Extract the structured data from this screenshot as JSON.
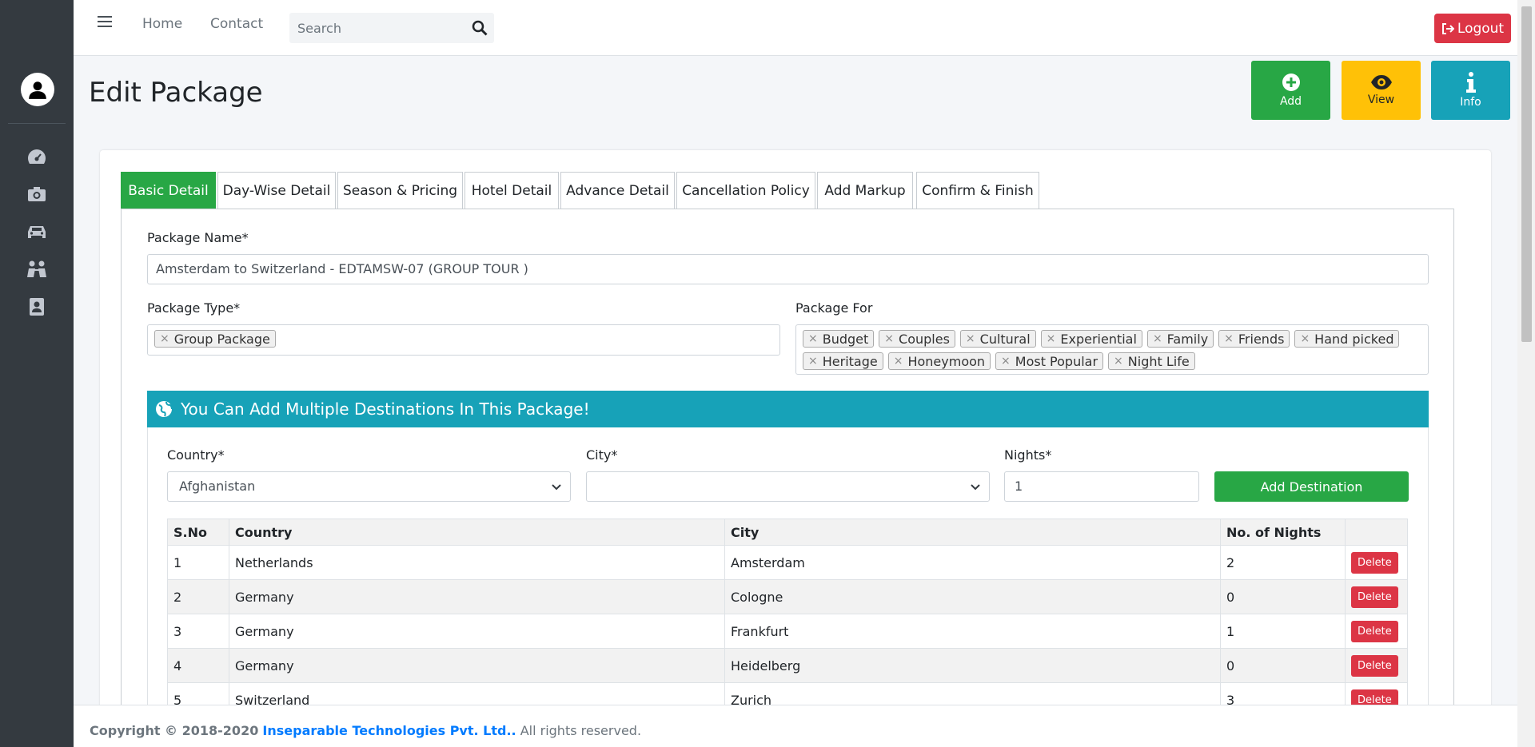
{
  "topbar": {
    "nav": [
      "Home",
      "Contact"
    ],
    "search_placeholder": "Search",
    "logout_label": "Logout"
  },
  "sidebar": {
    "icons": [
      "dashboard-icon",
      "camera-icon",
      "car-icon",
      "people-icon",
      "contact-book-icon"
    ]
  },
  "header": {
    "title": "Edit Package",
    "actions": [
      {
        "label": "Add",
        "color": "#28a745",
        "icon": "plus-circle-icon"
      },
      {
        "label": "View",
        "color": "#ffc107",
        "icon": "eye-icon"
      },
      {
        "label": "Info",
        "color": "#17a2b8",
        "icon": "info-icon"
      }
    ]
  },
  "tabs": [
    "Basic Detail",
    "Day-Wise Detail",
    "Season & Pricing",
    "Hotel Detail",
    "Advance Detail",
    "Cancellation Policy",
    "Add Markup",
    "Confirm & Finish"
  ],
  "form": {
    "package_name_label": "Package Name*",
    "package_name_value": "Amsterdam to Switzerland - EDTAMSW-07 (GROUP TOUR )",
    "package_type_label": "Package Type*",
    "package_type_values": [
      "Group Package"
    ],
    "package_for_label": "Package For",
    "package_for_values": [
      "Budget",
      "Couples",
      "Cultural",
      "Experiential",
      "Family",
      "Friends",
      "Hand picked",
      "Heritage",
      "Honeymoon",
      "Most Popular",
      "Night Life"
    ]
  },
  "destinations": {
    "header": "You Can Add Multiple Destinations In This Package!",
    "country_label": "Country*",
    "country_value": "Afghanistan",
    "city_label": "City*",
    "city_value": "",
    "nights_label": "Nights*",
    "nights_value": "1",
    "add_button": "Add Destination",
    "columns": [
      "S.No",
      "Country",
      "City",
      "No. of Nights",
      ""
    ],
    "delete_label": "Delete",
    "rows": [
      {
        "sno": "1",
        "country": "Netherlands",
        "city": "Amsterdam",
        "nights": "2"
      },
      {
        "sno": "2",
        "country": "Germany",
        "city": "Cologne",
        "nights": "0"
      },
      {
        "sno": "3",
        "country": "Germany",
        "city": "Frankfurt",
        "nights": "1"
      },
      {
        "sno": "4",
        "country": "Germany",
        "city": "Heidelberg",
        "nights": "0"
      },
      {
        "sno": "5",
        "country": "Switzerland",
        "city": "Zurich",
        "nights": "3"
      }
    ]
  },
  "footer": {
    "prefix": "Copyright © 2018-2020",
    "brand": "Inseparable Technologies Pvt. Ltd..",
    "suffix": "All rights reserved."
  }
}
